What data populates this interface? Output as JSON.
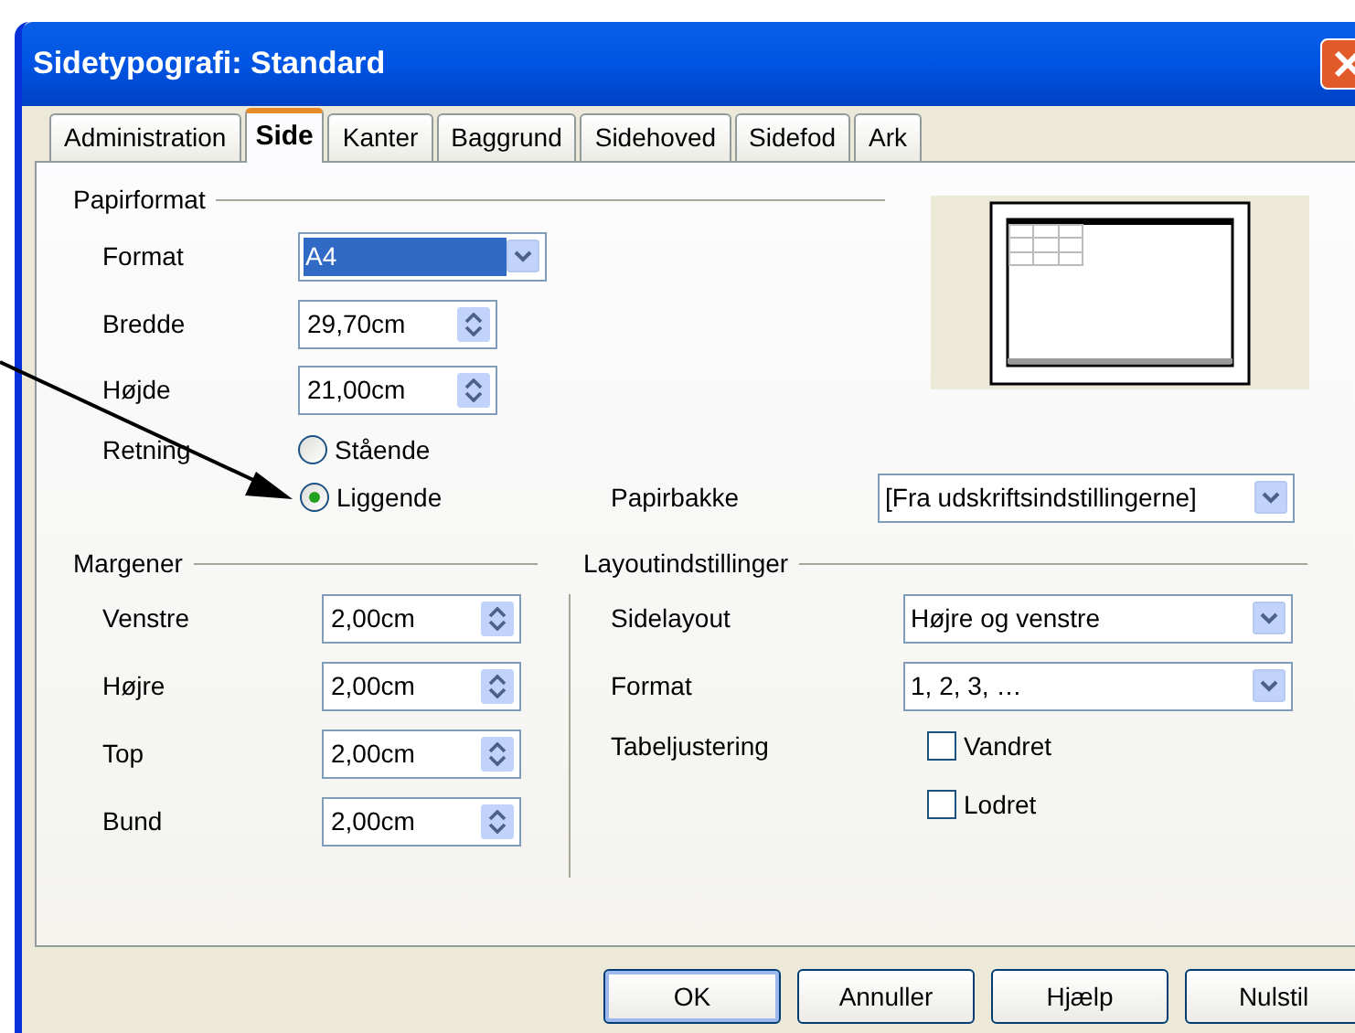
{
  "window": {
    "title": "Sidetypografi: Standard"
  },
  "tabs": [
    {
      "label": "Administration",
      "selected": false
    },
    {
      "label": "Side",
      "selected": true
    },
    {
      "label": "Kanter",
      "selected": false
    },
    {
      "label": "Baggrund",
      "selected": false
    },
    {
      "label": "Sidehoved",
      "selected": false
    },
    {
      "label": "Sidefod",
      "selected": false
    },
    {
      "label": "Ark",
      "selected": false
    }
  ],
  "paper_format": {
    "heading": "Papirformat",
    "format": {
      "label": "Format",
      "value": "A4",
      "focused": true
    },
    "width": {
      "label": "Bredde",
      "value": "29,70cm"
    },
    "height": {
      "label": "Højde",
      "value": "21,00cm"
    },
    "orientation": {
      "label": "Retning",
      "options": [
        {
          "label": "Stående",
          "selected": false
        },
        {
          "label": "Liggende",
          "selected": true
        }
      ]
    },
    "paper_tray": {
      "label": "Papirbakke",
      "value": "[Fra udskriftsindstillingerne]"
    }
  },
  "margins": {
    "heading": "Margener",
    "fields": [
      {
        "label": "Venstre",
        "value": "2,00cm"
      },
      {
        "label": "Højre",
        "value": "2,00cm"
      },
      {
        "label": "Top",
        "value": "2,00cm"
      },
      {
        "label": "Bund",
        "value": "2,00cm"
      }
    ]
  },
  "layout": {
    "heading": "Layoutindstillinger",
    "page_layout": {
      "label": "Sidelayout",
      "value": "Højre og venstre"
    },
    "format": {
      "label": "Format",
      "value": "1, 2, 3, …"
    },
    "table_alignment": {
      "label": "Tabeljustering",
      "options": [
        {
          "label": "Vandret",
          "checked": false
        },
        {
          "label": "Lodret",
          "checked": false
        }
      ]
    }
  },
  "buttons": [
    {
      "label": "OK",
      "default": true
    },
    {
      "label": "Annuller",
      "default": false
    },
    {
      "label": "Hjælp",
      "default": false
    },
    {
      "label": "Nulstil",
      "default": false
    }
  ]
}
